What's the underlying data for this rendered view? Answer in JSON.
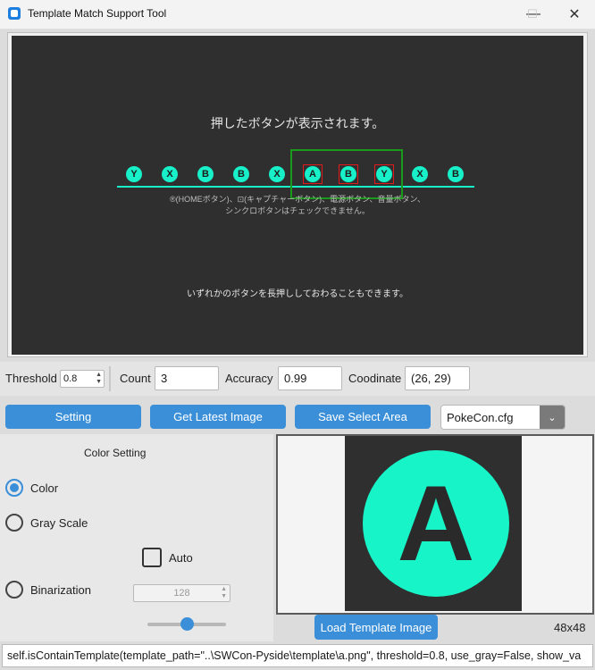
{
  "window": {
    "title": "Template Match Support Tool",
    "minimize": "—",
    "maximize": "☐",
    "close": "✕"
  },
  "preview": {
    "heading": "押したボタンが表示されます。",
    "buttons": [
      "Y",
      "X",
      "B",
      "B",
      "X",
      "A",
      "B",
      "Y",
      "X",
      "B"
    ],
    "note_line1": "®(HOMEボタン)、⊡(キャプチャーボタン)、電源ボタン、音量ボタン、",
    "note_line2": "シンクロボタンはチェックできません。",
    "footer": "いずれかのボタンを長押ししておわることもできます。",
    "accent_color": "#17f0c8"
  },
  "controls": {
    "threshold_label": "Threshold",
    "threshold_value": "0.8",
    "count_label": "Count",
    "count_value": "3",
    "accuracy_label": "Accuracy",
    "accuracy_value": "0.99",
    "coordinate_label": "Coodinate",
    "coordinate_value": "(26, 29)"
  },
  "toolbar": {
    "setting": "Setting",
    "get_latest_image": "Get Latest Image",
    "save_select_area": "Save Select Area",
    "config_selected": "PokeCon.cfg"
  },
  "color_setting": {
    "title": "Color Setting",
    "color": "Color",
    "gray_scale": "Gray Scale",
    "auto": "Auto",
    "binarization": "Binarization",
    "binarization_value": "128",
    "binarization_slider": 0.5
  },
  "template": {
    "letter": "A",
    "load_button": "Load Template Image",
    "size": "48x48"
  },
  "status": {
    "code": "self.isContainTemplate(template_path=\"..\\SWCon-Pyside\\template\\a.png\", threshold=0.8, use_gray=False, show_va"
  },
  "colors": {
    "accent_blue": "#3a8fd8",
    "teal": "#17f0c8",
    "dark": "#2f2f2f"
  }
}
